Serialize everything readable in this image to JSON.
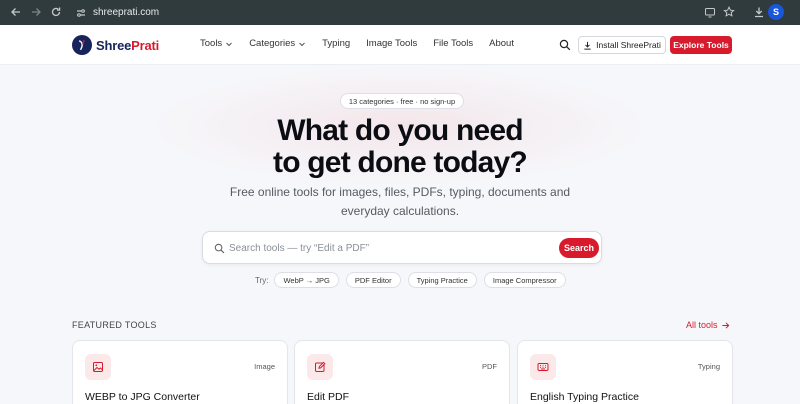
{
  "browser": {
    "url": "shreeprati.com",
    "profile_initial": "S"
  },
  "header": {
    "logo": {
      "part1": "Shree",
      "part2": "Prati"
    },
    "nav": [
      {
        "label": "Tools",
        "has_dropdown": true
      },
      {
        "label": "Categories",
        "has_dropdown": true
      },
      {
        "label": "Typing",
        "has_dropdown": false
      },
      {
        "label": "Image Tools",
        "has_dropdown": false
      },
      {
        "label": "File Tools",
        "has_dropdown": false
      },
      {
        "label": "About",
        "has_dropdown": false
      }
    ],
    "install_label": "Install ShreePrati",
    "explore_label": "Explore Tools"
  },
  "hero": {
    "pill": "13 categories · free · no sign-up",
    "title_line1": "What do you need",
    "title_line2": "to get done today?",
    "subtitle_line1": "Free online tools for images, files, PDFs, typing, documents and",
    "subtitle_line2": "everyday calculations.",
    "search_placeholder": "Search tools — try “Edit a PDF”",
    "search_button": "Search",
    "try_label": "Try:",
    "try_chips": [
      "WebP → JPG",
      "PDF Editor",
      "Typing Practice",
      "Image Compressor"
    ]
  },
  "featured": {
    "heading": "FEATURED TOOLS",
    "all_tools_label": "All tools",
    "cards": [
      {
        "icon": "image-icon",
        "tag": "Image",
        "title": "WEBP to JPG Converter"
      },
      {
        "icon": "edit-icon",
        "tag": "PDF",
        "title": "Edit PDF"
      },
      {
        "icon": "keyboard-icon",
        "tag": "Typing",
        "title": "English Typing Practice"
      }
    ]
  },
  "colors": {
    "brand_red": "#d81b2c",
    "brand_navy": "#17245c",
    "browser_bar": "#2f3b3c"
  }
}
